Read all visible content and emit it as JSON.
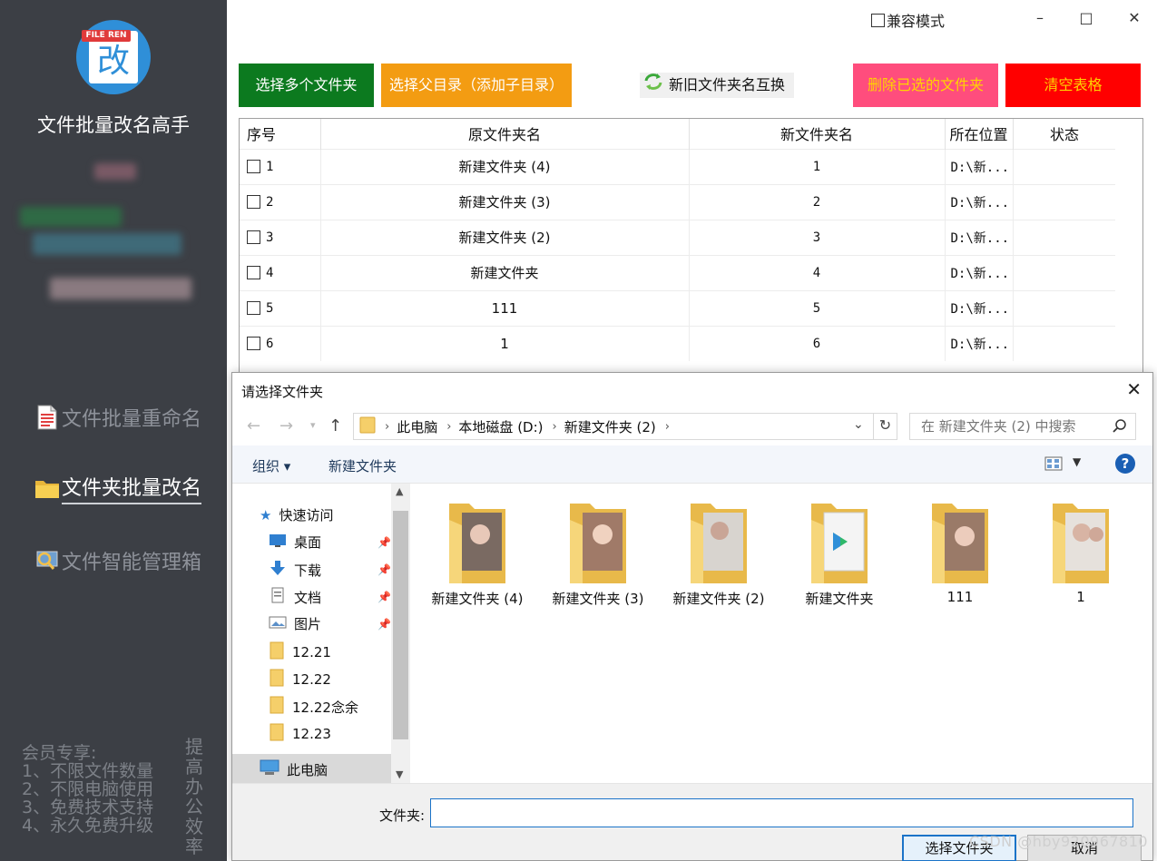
{
  "sidebar": {
    "logo_tag": "FILE REN",
    "logo_char": "改",
    "app_title": "文件批量改名高手",
    "nav": [
      {
        "label": "文件批量重命名"
      },
      {
        "label": "文件夹批量改名"
      },
      {
        "label": "文件智能管理箱"
      }
    ],
    "member_title": "会员专享:",
    "member_lines": [
      "1、不限文件数量",
      "2、不限电脑使用",
      "3、免费技术支持",
      "4、永久免费升级"
    ],
    "slogan": "提高办公效率"
  },
  "window": {
    "compat_label": "兼容模式",
    "minimize": "–",
    "maximize": "□",
    "close": "✕"
  },
  "toolbar": {
    "select_multi": "选择多个文件夹",
    "select_parent": "选择父目录（添加子目录）",
    "swap": "新旧文件夹名互换",
    "delete_selected": "删除已选的文件夹",
    "clear_table": "清空表格",
    "colors": {
      "green": "#0c7a1f",
      "orange": "#f39c12",
      "pink": "#ff4d7d",
      "red": "#ff0000",
      "pink_text": "#ffd400",
      "red_text": "#ffd400"
    }
  },
  "table": {
    "headers": [
      "序号",
      "原文件夹名",
      "新文件夹名",
      "所在位置",
      "状态"
    ],
    "rows": [
      {
        "idx": "1",
        "old": "新建文件夹 (4)",
        "new": "1",
        "loc": "D:\\新...",
        "status": ""
      },
      {
        "idx": "2",
        "old": "新建文件夹 (3)",
        "new": "2",
        "loc": "D:\\新...",
        "status": ""
      },
      {
        "idx": "3",
        "old": "新建文件夹 (2)",
        "new": "3",
        "loc": "D:\\新...",
        "status": ""
      },
      {
        "idx": "4",
        "old": "新建文件夹",
        "new": "4",
        "loc": "D:\\新...",
        "status": ""
      },
      {
        "idx": "5",
        "old": "111",
        "new": "5",
        "loc": "D:\\新...",
        "status": ""
      },
      {
        "idx": "6",
        "old": "1",
        "new": "6",
        "loc": "D:\\新...",
        "status": ""
      }
    ]
  },
  "dialog": {
    "title": "请选择文件夹",
    "breadcrumb": [
      "此电脑",
      "本地磁盘 (D:)",
      "新建文件夹 (2)"
    ],
    "search_placeholder": "在 新建文件夹 (2) 中搜索",
    "organize": "组织 ▾",
    "new_folder": "新建文件夹",
    "help": "?",
    "tree": [
      {
        "label": "快速访问",
        "icon": "star-icon"
      },
      {
        "label": "桌面",
        "icon": "desktop-icon",
        "pinned": true
      },
      {
        "label": "下载",
        "icon": "download-icon",
        "pinned": true
      },
      {
        "label": "文档",
        "icon": "document-icon",
        "pinned": true
      },
      {
        "label": "图片",
        "icon": "pictures-icon",
        "pinned": true
      },
      {
        "label": "12.21",
        "icon": "folder-icon"
      },
      {
        "label": "12.22",
        "icon": "folder-icon"
      },
      {
        "label": "12.22念余",
        "icon": "folder-icon"
      },
      {
        "label": "12.23",
        "icon": "folder-icon"
      },
      {
        "label": "此电脑",
        "icon": "computer-icon"
      }
    ],
    "files": [
      {
        "name": "新建文件夹 (4)"
      },
      {
        "name": "新建文件夹 (3)"
      },
      {
        "name": "新建文件夹 (2)"
      },
      {
        "name": "新建文件夹"
      },
      {
        "name": "111"
      },
      {
        "name": "1"
      }
    ],
    "folder_label": "文件夹:",
    "folder_value": "",
    "ok_label": "选择文件夹",
    "cancel_label": "取消"
  },
  "watermark": "CSDN @hby920967810"
}
